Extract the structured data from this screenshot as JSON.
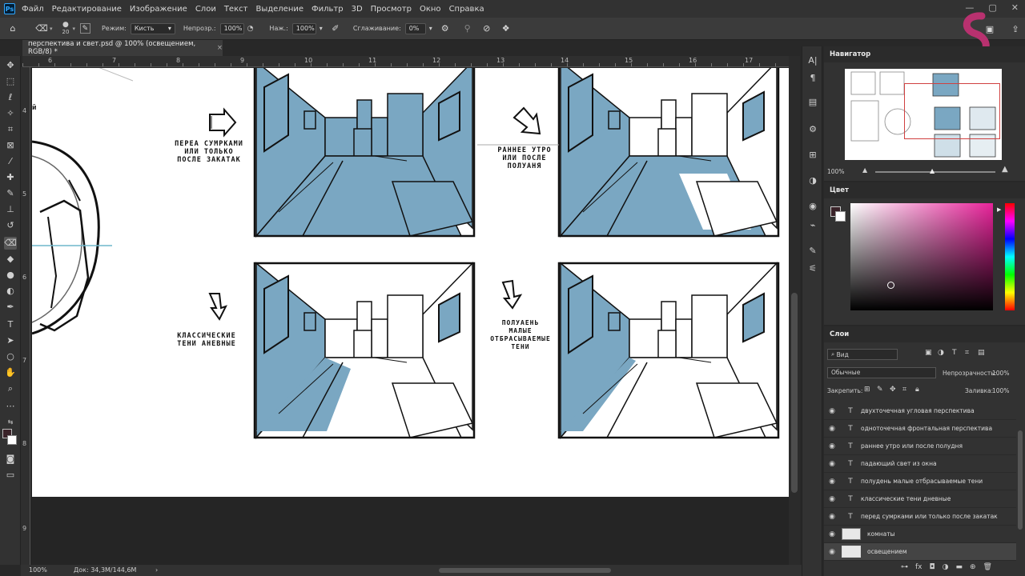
{
  "app": {
    "logo": "Ps"
  },
  "menu": [
    "Файл",
    "Редактирование",
    "Изображение",
    "Слои",
    "Текст",
    "Выделение",
    "Фильтр",
    "3D",
    "Просмотр",
    "Окно",
    "Справка"
  ],
  "options": {
    "brush_size": "20",
    "mode_label": "Режим:",
    "mode_value": "Кисть",
    "opacity_label": "Непрозр.:",
    "opacity_value": "100%",
    "pressure_label": "Наж.:",
    "pressure_value": "100%",
    "smoothing_label": "Сглаживание:",
    "smoothing_value": "0%"
  },
  "document_tab": {
    "title": "перспектива и свет.psd @ 100% (освещением, RGB/8) *",
    "close": "×"
  },
  "ruler": {
    "h_ticks": [
      "6",
      "7",
      "8",
      "9",
      "10",
      "11",
      "12",
      "13",
      "14",
      "15",
      "16",
      "17"
    ],
    "v_ticks": [
      "4",
      "5",
      "6",
      "7",
      "8",
      "9"
    ]
  },
  "status": {
    "zoom": "100%",
    "doc": "Док: 34,3M/144,6M"
  },
  "canvas_labels": {
    "top_left": "Переа сумрками\nили только\nпосле закатак",
    "top_right": "Раннее утро\nили после\nполуаня",
    "bottom_left": "классические\nтени аневные",
    "bottom_right": "полуаень\nмалые\nотбрасываемые\nтени",
    "edge": "й"
  },
  "navigator": {
    "title": "Навигатор",
    "zoom": "100%"
  },
  "color": {
    "title": "Цвет",
    "foreground": "#3a2329",
    "background": "#ffffff"
  },
  "layers": {
    "title": "Слои",
    "search": "Вид",
    "blend": "Обычные",
    "opacity_label": "Непрозрачность:",
    "opacity_value": "100%",
    "lock_label": "Закрепить:",
    "fill_label": "Заливка:",
    "fill_value": "100%",
    "items": [
      {
        "type": "T",
        "name": "двухточечная угловая перспектива"
      },
      {
        "type": "T",
        "name": "одноточечная фронтальная перспектива"
      },
      {
        "type": "T",
        "name": "раннее утро или после полудня"
      },
      {
        "type": "T",
        "name": "падающий свет из окна"
      },
      {
        "type": "T",
        "name": "полудень малые отбрасываемые тени"
      },
      {
        "type": "T",
        "name": "классические тени дневные"
      },
      {
        "type": "T",
        "name": "перед сумрками или только после закатак"
      },
      {
        "type": "img",
        "name": "комнаты"
      },
      {
        "type": "img",
        "name": "освещением"
      }
    ]
  },
  "colors": {
    "shade": "#7aa7c2",
    "ui_bg": "#323232",
    "accent_logo": "#b8316f"
  }
}
